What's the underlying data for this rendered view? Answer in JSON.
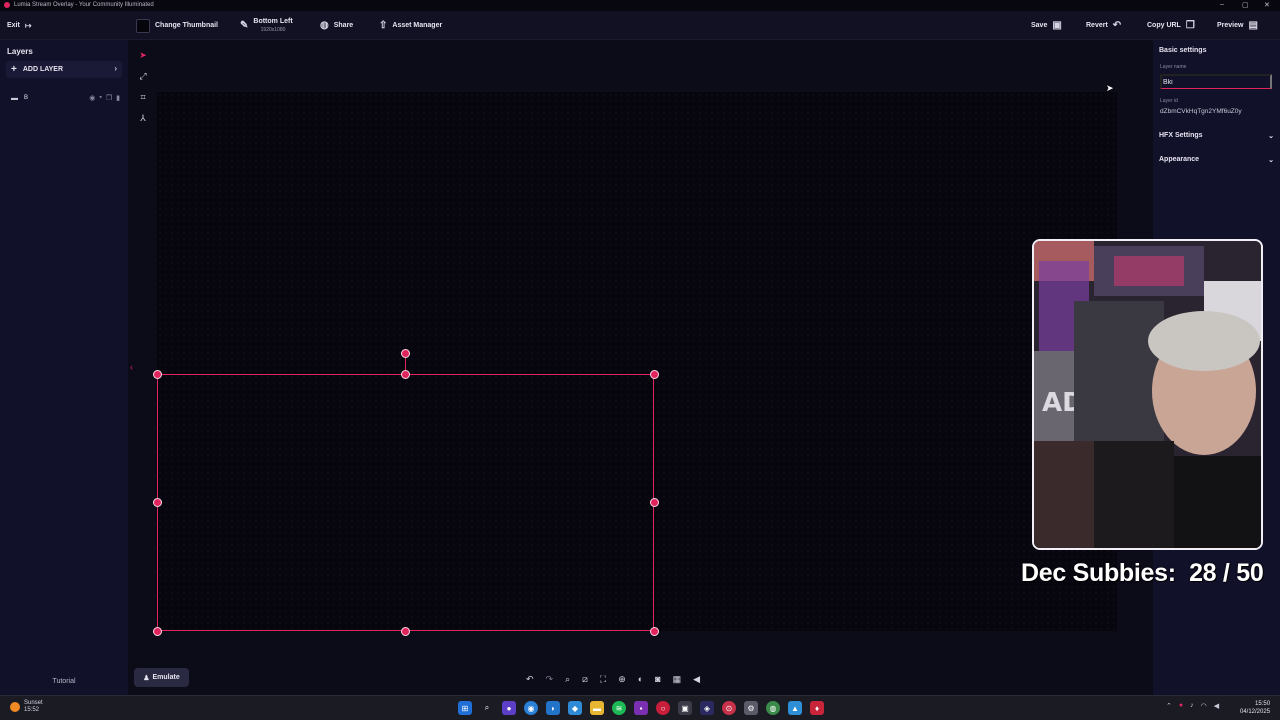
{
  "window": {
    "title": "Lumia Stream Overlay - Your Community Illuminated",
    "minimize": "–",
    "maximize": "▢",
    "close": "✕"
  },
  "toolbar": {
    "exit_label": "Exit",
    "exit_icon": "exit-icon",
    "change_thumbnail_label": "Change Thumbnail",
    "position_label": "Bottom Left",
    "resolution": "1920x1080",
    "share_label": "Share",
    "asset_manager_label": "Asset Manager",
    "save_label": "Save",
    "revert_label": "Revert",
    "copy_url_label": "Copy URL",
    "preview_label": "Preview"
  },
  "left_panel": {
    "title": "Layers",
    "add_layer_label": "ADD LAYER",
    "layers": [
      {
        "name": "B"
      }
    ],
    "tutorial_label": "Tutorial"
  },
  "right_panel": {
    "section_title": "Basic settings",
    "layer_name_label": "Layer name",
    "layer_name_value": "Bki",
    "layer_id_label": "Layer id",
    "layer_id_value": "dZbmCVkHqTgn2YMf6uZ0y",
    "hfx_settings_label": "HFX Settings",
    "appearance_label": "Appearance"
  },
  "canvas": {
    "emulate_label": "Emulate",
    "overlay_text": "Dec Subbies:  28 / 50"
  },
  "taskbar": {
    "weather_label": "Sunset",
    "weather_time": "15:52",
    "clock_time": "15:50",
    "clock_date": "04/12/2025"
  },
  "colors": {
    "accent": "#e0245e",
    "background": "#0b0a17",
    "panel": "#12112a"
  }
}
